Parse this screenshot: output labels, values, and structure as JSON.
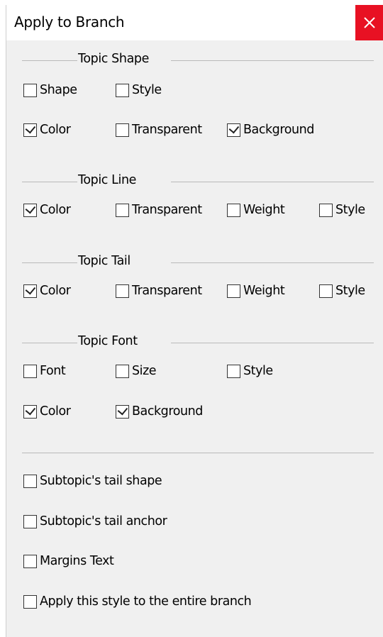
{
  "window": {
    "title": "Apply to Branch",
    "close_icon": "close-icon"
  },
  "sections": {
    "shape": {
      "title": "Topic Shape",
      "items": [
        {
          "label": "Shape",
          "checked": false
        },
        {
          "label": "Style",
          "checked": false
        },
        {
          "label": "Color",
          "checked": true
        },
        {
          "label": "Transparent",
          "checked": false
        },
        {
          "label": "Background",
          "checked": true
        }
      ]
    },
    "line": {
      "title": "Topic Line",
      "items": [
        {
          "label": "Color",
          "checked": true
        },
        {
          "label": "Transparent",
          "checked": false
        },
        {
          "label": "Weight",
          "checked": false
        },
        {
          "label": "Style",
          "checked": false
        }
      ]
    },
    "tail": {
      "title": "Topic Tail",
      "items": [
        {
          "label": "Color",
          "checked": true
        },
        {
          "label": "Transparent",
          "checked": false
        },
        {
          "label": "Weight",
          "checked": false
        },
        {
          "label": "Style",
          "checked": false
        }
      ]
    },
    "font": {
      "title": "Topic Font",
      "items": [
        {
          "label": "Font",
          "checked": false
        },
        {
          "label": "Size",
          "checked": false
        },
        {
          "label": "Style",
          "checked": false
        },
        {
          "label": "Color",
          "checked": true
        },
        {
          "label": "Background",
          "checked": true
        }
      ]
    }
  },
  "options": [
    {
      "label": "Subtopic's tail shape",
      "checked": false
    },
    {
      "label": "Subtopic's tail anchor",
      "checked": false
    },
    {
      "label": "Margins Text",
      "checked": false
    },
    {
      "label": "Apply this style to the entire branch",
      "checked": false
    }
  ],
  "colors": {
    "close_bg": "#e81123",
    "dialog_bg": "#f0f0f0",
    "line": "#b9b9b9"
  }
}
